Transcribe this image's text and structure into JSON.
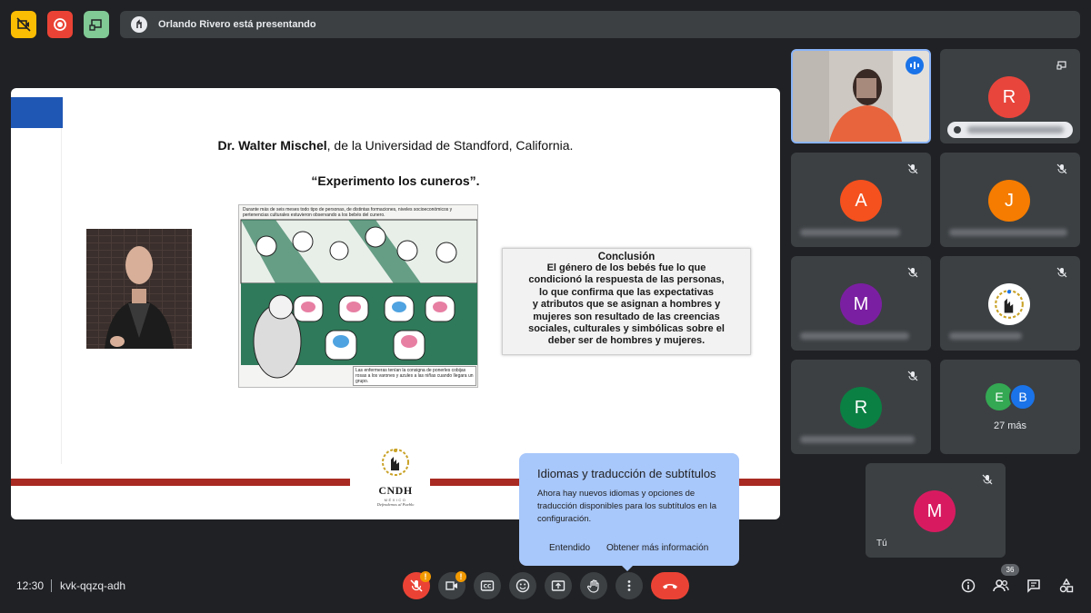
{
  "top_bar": {
    "presenting_text": "Orlando Rivero está presentando",
    "colors": {
      "yellow": "#fbbc04",
      "red": "#ea4335",
      "green": "#81c995"
    }
  },
  "slide": {
    "title_bold": "Dr. Walter Mischel",
    "title_rest": ", de la Universidad de Standford, California.",
    "subtitle": "“Experimento los cuneros”.",
    "comic_caption_top": "Durante más de seis meses todo tipo de personas, de distintas formaciones, niveles socioeconómicos y pertenencias culturales estuvieron observando a los bebés del cunero.",
    "comic_caption_bottom": "Las enfermeras tenían la consigna de ponerles cobijas rosas a los varones y azules a las niñas cuando llegara un grupo.",
    "conclusion_heading": "Conclusión",
    "conclusion_lines": [
      "El género de los bebés fue lo que",
      "condicionó la respuesta de las personas,",
      "lo que confirma que las expectativas",
      "y atributos que se asignan a hombres y",
      "mujeres son resultado de las creencias",
      "sociales, culturales y simbólicas sobre el",
      "deber ser de hombres y mujeres."
    ],
    "logo_title": "CNDH",
    "logo_sub": "MÉXICO",
    "logo_tag": "Defendemos al Pueblo"
  },
  "tiles": {
    "presenter_speaking": true,
    "r1": {
      "initial": "R",
      "color": "#e8453c"
    },
    "a": {
      "initial": "A",
      "color": "#f4511e"
    },
    "j": {
      "initial": "J",
      "color": "#f57c00"
    },
    "m1": {
      "initial": "M",
      "color": "#7b1fa2"
    },
    "r2": {
      "initial": "R",
      "color": "#0b8043"
    },
    "more": {
      "initial1": "E",
      "initial2": "B",
      "label": "27 más",
      "color1": "#34a853",
      "color2": "#1a73e8"
    },
    "self": {
      "initial": "M",
      "label": "Tú",
      "color": "#d81b60"
    }
  },
  "bottom_bar": {
    "time": "12:30",
    "meeting_code": "kvk-qqzq-adh",
    "warn_badge": "!",
    "participant_count": "36"
  },
  "tooltip": {
    "title": "Idiomas y traducción de subtítulos",
    "body": "Ahora hay nuevos idiomas y opciones de traducción disponibles para los subtítulos en la configuración.",
    "dismiss": "Entendido",
    "learn_more": "Obtener más información"
  }
}
